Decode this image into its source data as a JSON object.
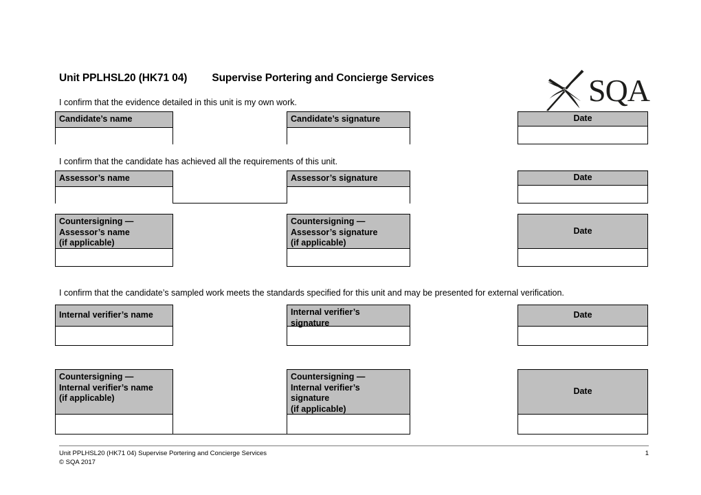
{
  "document": {
    "title_code": "Unit PPLHSL20 (HK71 04)",
    "title_name": "Supervise Portering and Concierge Services",
    "logo_text": "SQA"
  },
  "statements": {
    "candidate": "I confirm that the evidence detailed in this unit is my own work.",
    "assessor": "I confirm that the candidate has achieved all the requirements of this unit.",
    "internal_verifier": "I confirm that the candidate’s sampled work meets the standards specified for this unit and may be presented for external verification."
  },
  "sections": [
    {
      "id": "candidate",
      "name_label": "Candidate’s name",
      "signature_label": "Candidate’s signature",
      "date_label": "Date"
    },
    {
      "id": "assessor",
      "name_label": "Assessor’s name",
      "signature_label": "Assessor’s signature",
      "date_label": "Date"
    },
    {
      "id": "countersigning-assessor",
      "name_label": "Countersigning —\nAssessor’s name\n(if applicable)",
      "signature_label": "Countersigning —\nAssessor’s signature\n(if applicable)",
      "date_label": "Date"
    },
    {
      "id": "internal-verifier",
      "name_label": "Internal verifier’s name",
      "signature_label": "Internal verifier’s\nsignature",
      "date_label": "Date"
    },
    {
      "id": "countersigning-internal-verifier",
      "name_label": "Countersigning —\nInternal verifier’s name\n(if applicable)",
      "signature_label": "Countersigning —\nInternal verifier’s\nsignature\n(if applicable)",
      "date_label": "Date"
    }
  ],
  "fields": {
    "candidate_name_value": "",
    "candidate_signature_value": "",
    "candidate_date_value": "",
    "assessor_name_value": "",
    "assessor_signature_value": "",
    "assessor_date_value": "",
    "cs_assessor_name_value": "",
    "cs_assessor_signature_value": "",
    "cs_assessor_date_value": "",
    "iv_name_value": "",
    "iv_signature_value": "",
    "iv_date_value": "",
    "cs_iv_name_value": "",
    "cs_iv_signature_value": "",
    "cs_iv_date_value": ""
  },
  "footer": {
    "unit_line": "Unit PPLHSL20 (HK71 04) Supervise Portering and Concierge Services",
    "page_number": "1",
    "copyright": "© SQA 2017"
  },
  "colors": {
    "header_fill": "#bfbfbf",
    "border": "#000000",
    "page_background": "#ffffff",
    "footer_rule": "#7a7a7a"
  }
}
